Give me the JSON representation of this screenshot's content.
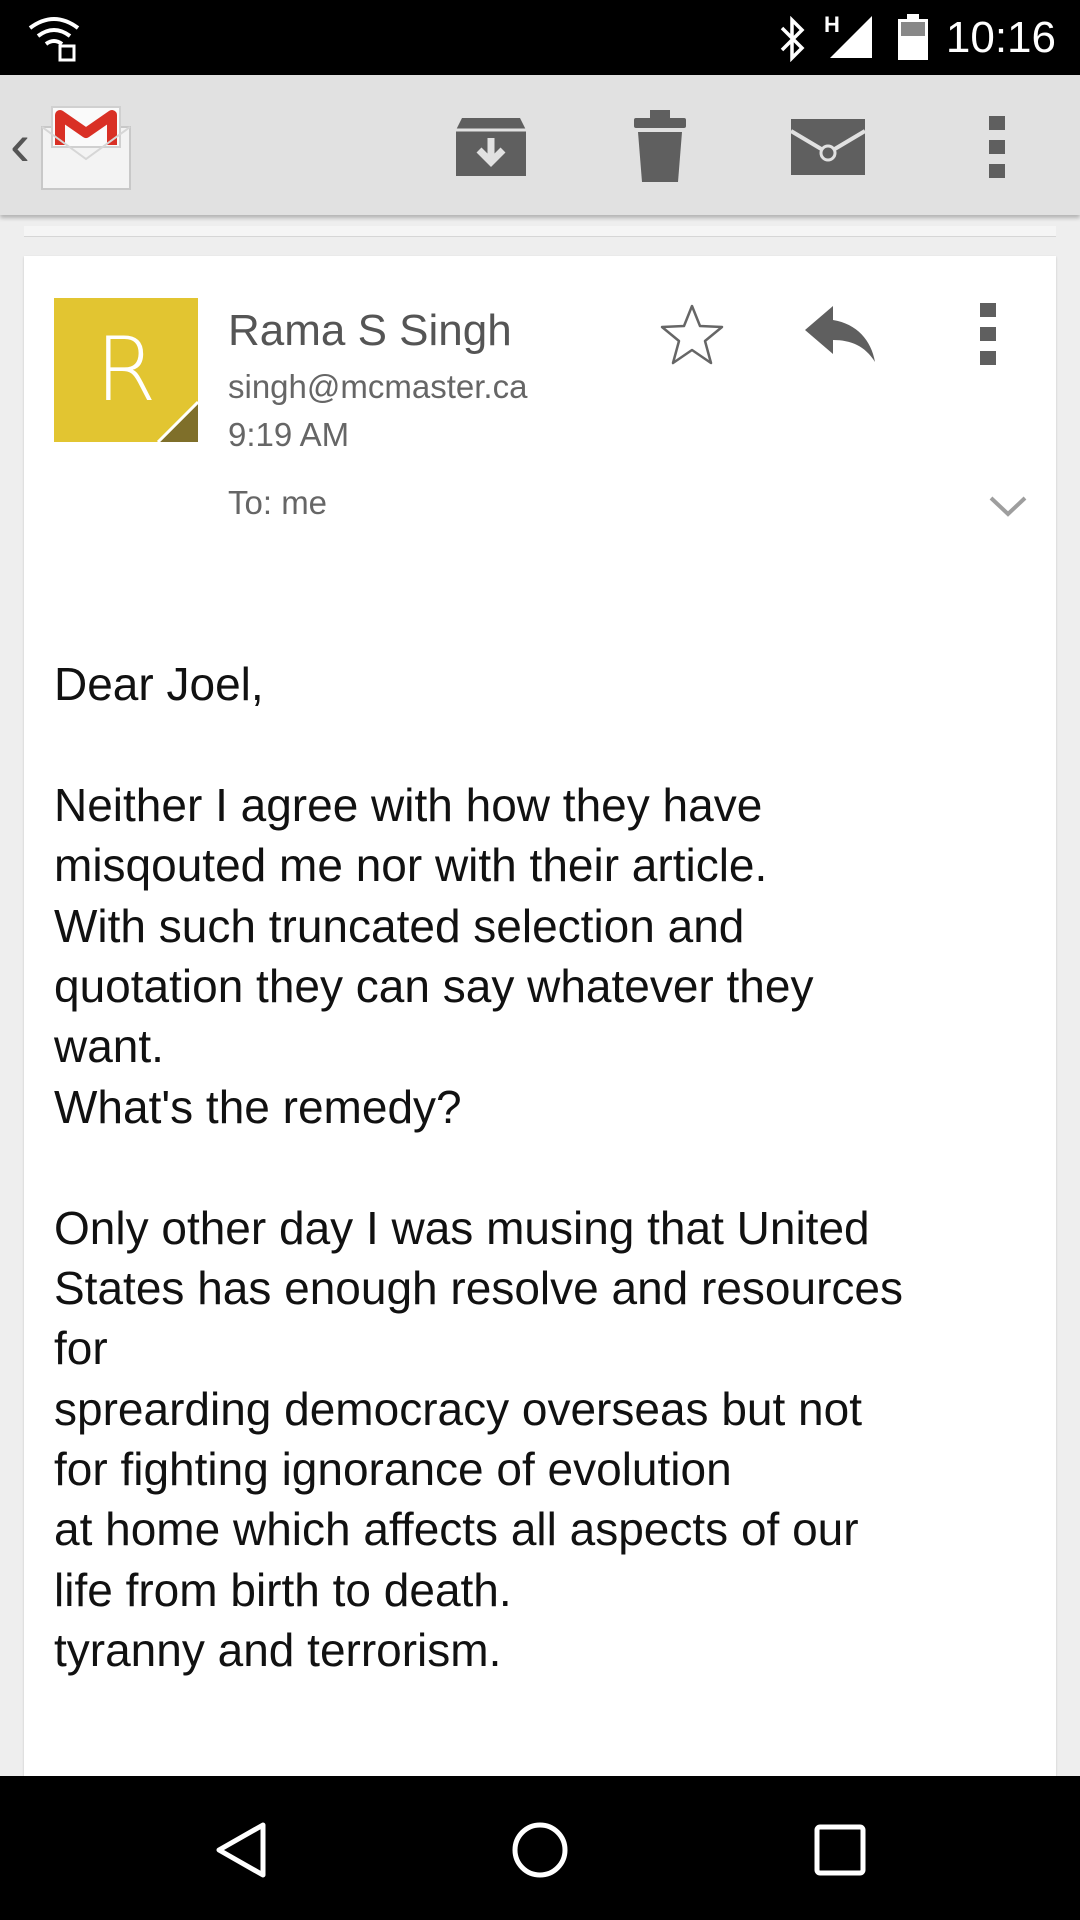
{
  "status_bar": {
    "time": "10:16",
    "network_type": "H",
    "icons": [
      "wifi-icon",
      "bluetooth-icon",
      "signal-icon",
      "battery-icon"
    ]
  },
  "toolbar": {
    "back": "‹",
    "app_icon": "gmail-icon",
    "actions": [
      "archive-icon",
      "delete-icon",
      "mark-unread-icon",
      "more-options-icon"
    ]
  },
  "message": {
    "avatar_letter": "R",
    "avatar_color": "#e2c531",
    "sender_name": "Rama S Singh",
    "sender_email": "singh@mcmaster.ca",
    "time": "9:19 AM",
    "to": "To: me",
    "body_lines": [
      "Dear Joel,",
      "",
      "Neither I agree with how they have",
      "misqouted me nor with their article.",
      "With such truncated selection and",
      "quotation they can say whatever they",
      "want.",
      "What's the remedy?",
      "",
      "Only other day I was musing that United",
      "States has enough resolve and resources",
      "for",
      "sprearding democracy overseas but not",
      "for fighting ignorance of evolution",
      "at home which affects all aspects of our",
      "life from birth to death.",
      "tyranny and terrorism."
    ]
  },
  "nav_bar": {
    "buttons": [
      "back-nav-icon",
      "home-nav-icon",
      "recents-nav-icon"
    ]
  }
}
